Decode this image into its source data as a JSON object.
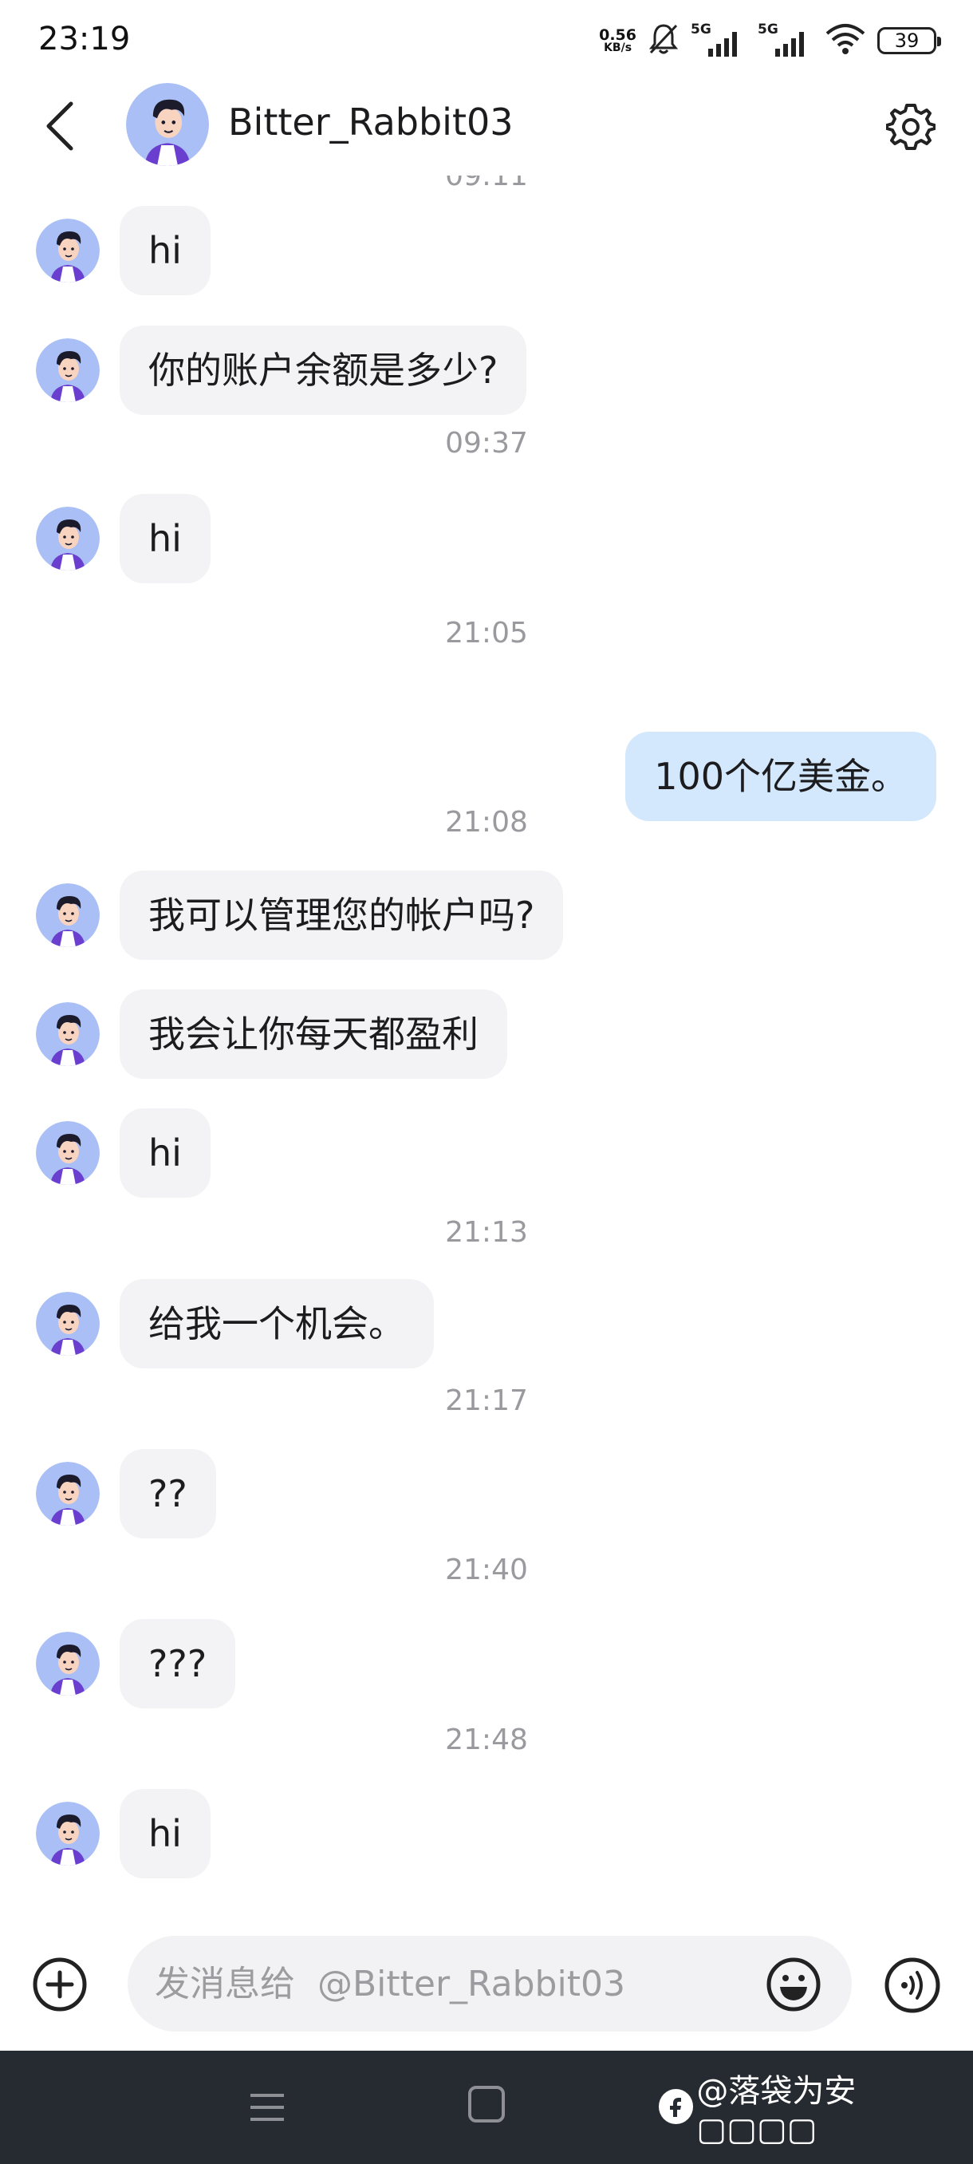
{
  "status_bar": {
    "time": "23:19",
    "speed_value": "0.56",
    "speed_unit": "KB/s",
    "signal1_label": "5G",
    "signal2_label": "5G",
    "battery": "39"
  },
  "header": {
    "contact_name": "Bitter_Rabbit03"
  },
  "chat": {
    "cut_timestamp": "09:11",
    "messages": [
      {
        "type": "in",
        "text": "hi"
      },
      {
        "type": "in",
        "text": "你的账户余额是多少?"
      },
      {
        "type": "time",
        "text": "09:37"
      },
      {
        "type": "in",
        "text": "hi"
      },
      {
        "type": "time",
        "text": "21:05"
      },
      {
        "type": "out",
        "text": "100个亿美金。"
      },
      {
        "type": "time",
        "text": "21:08"
      },
      {
        "type": "in",
        "text": "我可以管理您的帐户吗?"
      },
      {
        "type": "in",
        "text": "我会让你每天都盈利"
      },
      {
        "type": "in",
        "text": "hi"
      },
      {
        "type": "time",
        "text": "21:13"
      },
      {
        "type": "in",
        "text": "给我一个机会。"
      },
      {
        "type": "time",
        "text": "21:17"
      },
      {
        "type": "in",
        "text": "??"
      },
      {
        "type": "time",
        "text": "21:40"
      },
      {
        "type": "in",
        "text": "???"
      },
      {
        "type": "time",
        "text": "21:48"
      },
      {
        "type": "in",
        "text": "hi"
      }
    ]
  },
  "input": {
    "placeholder": "发消息给  @Bitter_Rabbit03"
  },
  "watermark": {
    "text": "@落袋为安▢▢▢▢"
  },
  "colors": {
    "incoming_bubble": "#f3f3f5",
    "outgoing_bubble": "#d4e8fd",
    "timestamp": "#9a9a9e",
    "nav_bar": "#262a31",
    "avatar_bg": "#a9bff5"
  }
}
